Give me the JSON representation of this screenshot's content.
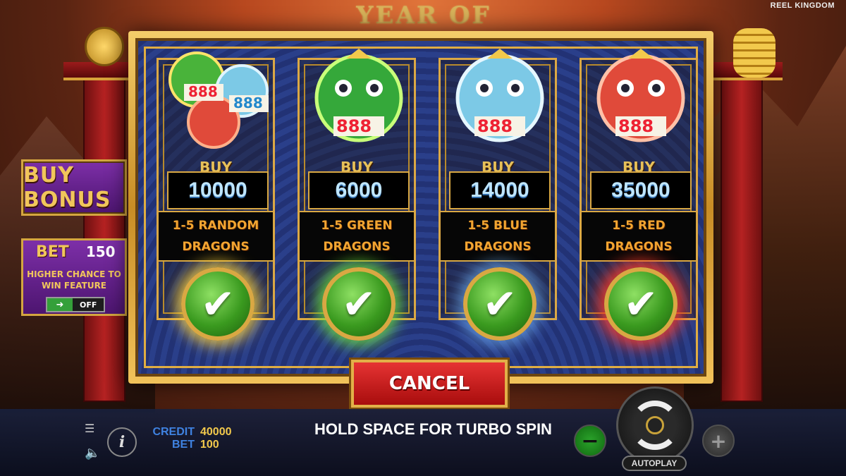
{
  "header": {
    "game_title": "YEAR OF THE",
    "brand": "REEL KINGDOM"
  },
  "left_panel": {
    "buy_bonus_label": "BUY BONUS",
    "bet_label": "BET",
    "bet_value": "150",
    "higher_chance_text": "HIGHER CHANCE TO WIN FEATURE",
    "toggle_state": "OFF"
  },
  "modal": {
    "cards": [
      {
        "buy_label": "BUY",
        "price": "10000",
        "description": "1-5 RANDOM DRAGONS",
        "glow": "yellow",
        "dragon_color": "#49b33a"
      },
      {
        "buy_label": "BUY",
        "price": "6000",
        "description": "1-5 GREEN DRAGONS",
        "glow": "green",
        "dragon_color": "#35a83a"
      },
      {
        "buy_label": "BUY",
        "price": "14000",
        "description": "1-5 BLUE DRAGONS",
        "glow": "blue",
        "dragon_color": "#7cc9e6"
      },
      {
        "buy_label": "BUY",
        "price": "35000",
        "description": "1-5 RED DRAGONS",
        "glow": "red",
        "dragon_color": "#e04a3a"
      }
    ],
    "cancel_label": "CANCEL"
  },
  "bottom_bar": {
    "credit_label": "CREDIT",
    "credit_value": "40000",
    "bet_label": "BET",
    "bet_value": "100",
    "turbo_hint": "HOLD SPACE FOR TURBO SPIN",
    "autoplay_label": "AUTOPLAY",
    "minus_symbol": "−",
    "plus_symbol": "+",
    "info_symbol": "i"
  },
  "colors": {
    "gold": "#dba845",
    "price_text": "#bfe6ff",
    "desc_text": "#f2a531",
    "cancel_red": "#c41616",
    "credit_label": "#3f82e0",
    "credit_value": "#f2c94c"
  }
}
